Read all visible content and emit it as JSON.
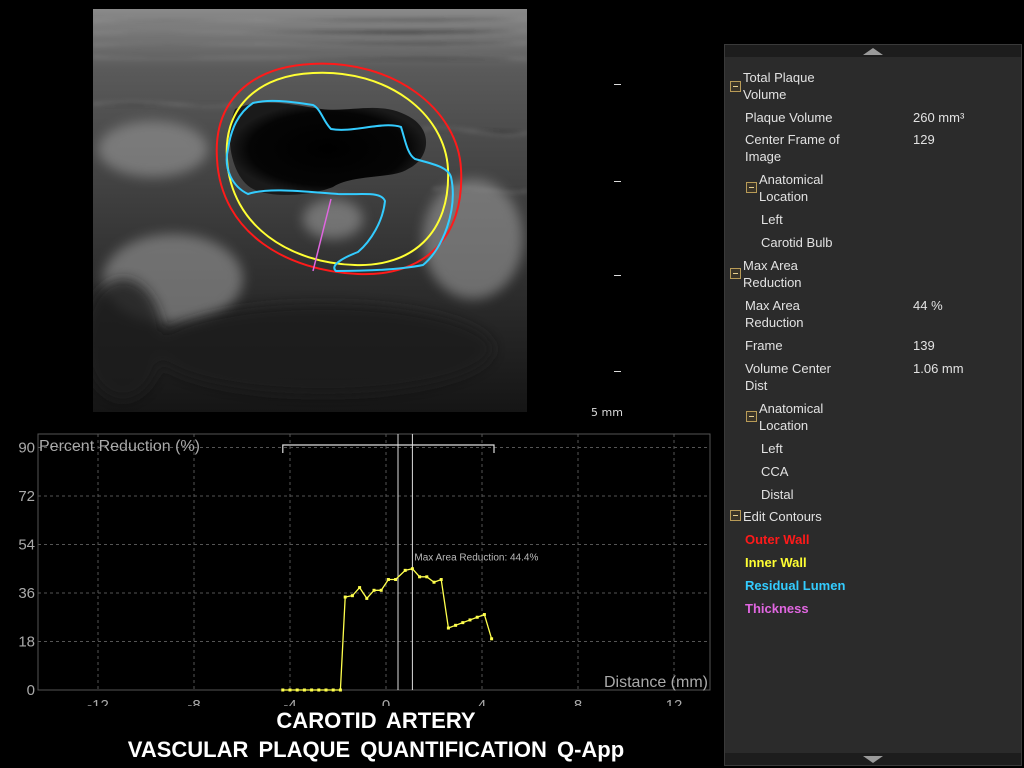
{
  "scale": {
    "label": "5 mm"
  },
  "chart_data": {
    "type": "line",
    "title": "Percent Reduction (%)",
    "xlabel": "Distance (mm)",
    "xlim": [
      -14.5,
      13.5
    ],
    "ylim": [
      0,
      95
    ],
    "x_ticks": [
      "-12",
      "-8",
      "-4",
      "0",
      "4",
      "8",
      "12"
    ],
    "x_tick_values": [
      -12,
      -8,
      -4,
      0,
      4,
      8,
      12
    ],
    "y_ticks": [
      "0",
      "18",
      "36",
      "54",
      "72",
      "90"
    ],
    "y_tick_values": [
      0,
      18,
      36,
      54,
      72,
      90
    ],
    "grid": true,
    "series": [
      {
        "x": [
          -4.3,
          -4.0,
          -3.7,
          -3.4,
          -3.1,
          -2.8,
          -2.5,
          -2.2,
          -1.9,
          -1.7,
          -1.4,
          -1.1,
          -0.8,
          -0.5,
          -0.2,
          0.1,
          0.4,
          0.8,
          1.1,
          1.4,
          1.7,
          2.0,
          2.3,
          2.6,
          2.9,
          3.2,
          3.5,
          3.8,
          4.1,
          4.4
        ],
        "y": [
          0,
          0,
          0,
          0,
          0,
          0,
          0,
          0,
          0,
          34.5,
          35,
          38,
          34,
          37,
          37,
          41,
          41,
          44.4,
          45,
          42,
          42,
          40,
          41,
          23,
          24,
          25,
          26,
          27,
          28,
          19
        ],
        "color": "#ffff4d"
      }
    ],
    "annotation": "Max Area Reduction: 44.4%",
    "annotation_x": 1.1,
    "annotation_y": 45,
    "cursor_lines_x": [
      0.5,
      1.1
    ],
    "range_bracket": [
      -4.3,
      4.5
    ]
  },
  "footer": {
    "line1": "CAROTID  ARTERY",
    "line2": "VASCULAR  PLAQUE  QUANTIFICATION  Q-App"
  },
  "panel": {
    "total_plaque_volume": "Total Plaque Volume",
    "plaque_volume_label": "Plaque Volume",
    "plaque_volume_value": "260 mm³",
    "center_frame_label": "Center Frame of Image",
    "center_frame_value": "129",
    "anatomical_location_1": "Anatomical Location",
    "left_1": "Left",
    "carotid_bulb": "Carotid Bulb",
    "max_area_reduction_header": "Max Area Reduction",
    "max_area_reduction_label": "Max Area Reduction",
    "max_area_reduction_value": "44 %",
    "frame_label": "Frame",
    "frame_value": "139",
    "volume_center_dist_label": "Volume Center Dist",
    "volume_center_dist_value": "1.06 mm",
    "anatomical_location_2": "Anatomical Location",
    "left_2": "Left",
    "cca": "CCA",
    "distal": "Distal",
    "edit_contours": "Edit Contours",
    "outer_wall": "Outer Wall",
    "inner_wall": "Inner Wall",
    "residual_lumen": "Residual Lumen",
    "thickness": "Thickness",
    "outer_wall_color": "#ff1a1a",
    "inner_wall_color": "#ffff33",
    "residual_lumen_color": "#33ccff",
    "thickness_color": "#e066e0"
  }
}
